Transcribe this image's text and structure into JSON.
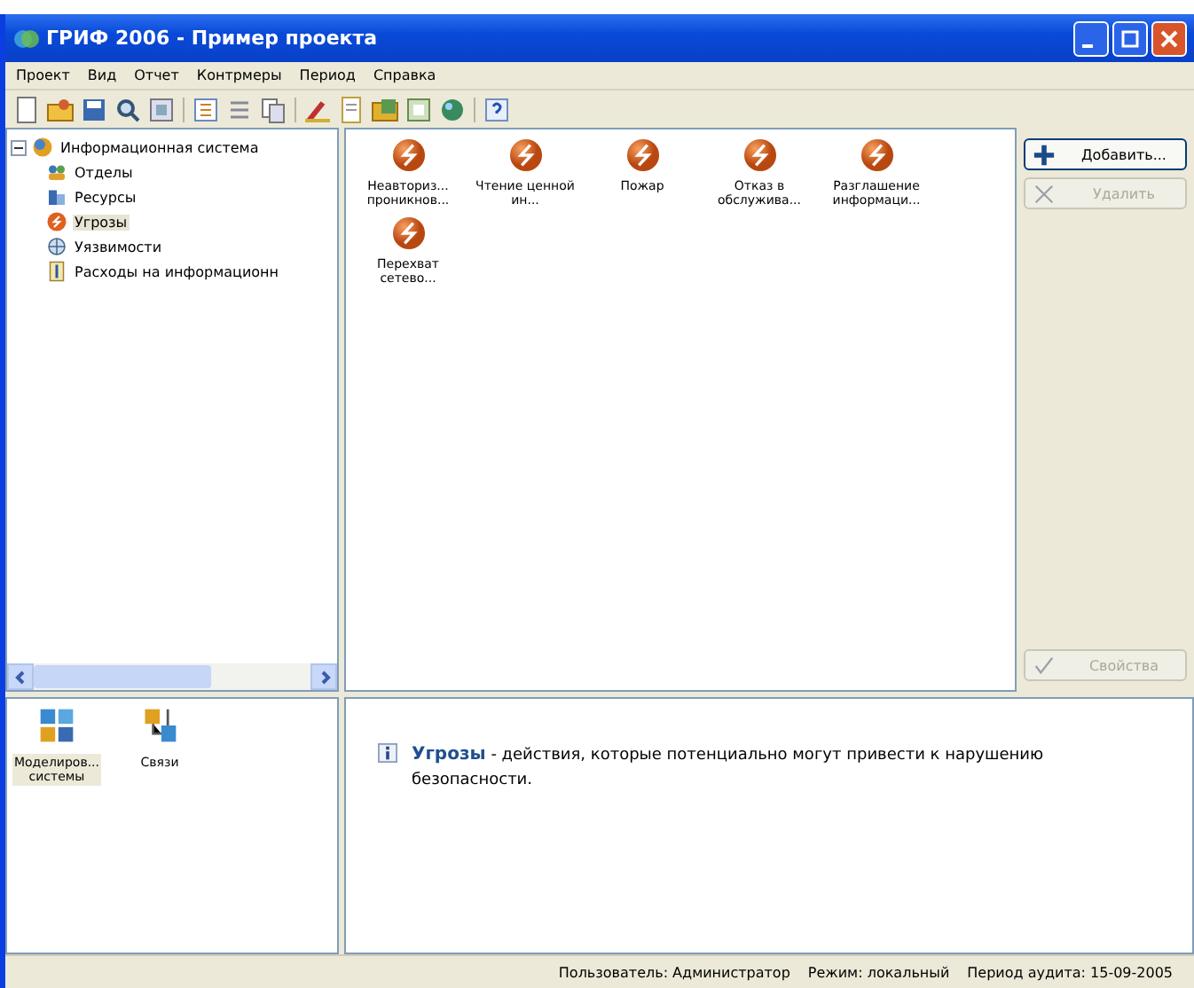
{
  "window": {
    "title": "ГРИФ 2006 - Пример проекта"
  },
  "menu": [
    "Проект",
    "Вид",
    "Отчет",
    "Контрмеры",
    "Период",
    "Справка"
  ],
  "tree": {
    "label": "Информационная система",
    "expanded": true,
    "children": [
      {
        "label": "Отделы",
        "kind": "departments",
        "selected": false
      },
      {
        "label": "Ресурсы",
        "kind": "resources",
        "selected": false
      },
      {
        "label": "Угрозы",
        "kind": "threats",
        "selected": true
      },
      {
        "label": "Уязвимости",
        "kind": "vulnerabilities",
        "selected": false
      },
      {
        "label": "Расходы на информационн",
        "kind": "costs",
        "selected": false
      }
    ]
  },
  "items": [
    {
      "label": "Неавториз... проникнов..."
    },
    {
      "label": "Чтение ценной ин..."
    },
    {
      "label": "Пожар"
    },
    {
      "label": "Отказ в обслужива..."
    },
    {
      "label": "Разглашение информаци..."
    },
    {
      "label": "Перехват сетево..."
    }
  ],
  "actions": [
    {
      "label": "Добавить...",
      "kind": "add",
      "disabled": false
    },
    {
      "label": "Удалить",
      "kind": "delete",
      "disabled": true
    },
    {
      "label": "Свойства",
      "kind": "properties",
      "disabled": true
    }
  ],
  "modes": [
    {
      "label": "Моделиров... системы",
      "kind": "model",
      "selected": true
    },
    {
      "label": "Связи",
      "kind": "links",
      "selected": false
    }
  ],
  "info": {
    "text": "**Угрозы** - действия, которые потенциально могут привести к нарушению безопасности."
  },
  "status_bar": [
    "Пользователь: Администратор",
    "Режим: локальный",
    "Период аудита: 15-09-2005"
  ]
}
